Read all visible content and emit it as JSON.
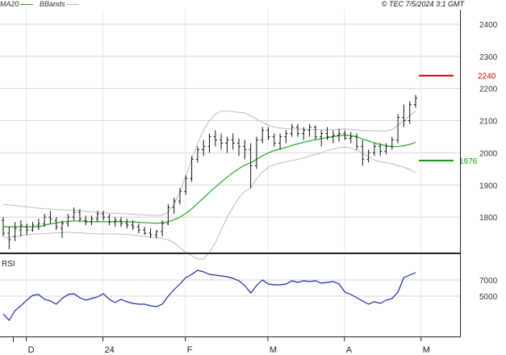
{
  "header": {
    "legend": [
      {
        "label": "MA20",
        "color": "#22aa22"
      },
      {
        "label": "BBands",
        "color": "#bbbbbb"
      }
    ],
    "copyright": "© TEC 7/5/2024 3:1 GMT"
  },
  "colors": {
    "price_bars": "#111111",
    "ma20": "#22aa22",
    "bbands": "#bbbbbb",
    "rsi": "#1a2aa8",
    "resistance": "#cc0000",
    "support": "#119911",
    "grid": "#d6d6d6",
    "axis": "#222222"
  },
  "chart_data": [
    {
      "type": "ohlc",
      "title": "",
      "x_tick_labels": [
        "D",
        "24",
        "F",
        "M",
        "A",
        "M"
      ],
      "y_tick_labels": [
        "2400",
        "2300",
        "2200",
        "2100",
        "2000",
        "1900",
        "1800"
      ],
      "ylim": [
        1690,
        2445
      ],
      "grid": true,
      "levels": [
        {
          "label": "2240",
          "value": 2240,
          "color": "#cc0000"
        },
        {
          "label": "1976",
          "value": 1976,
          "color": "#119911"
        }
      ],
      "series": [
        {
          "name": "",
          "kind": "ohlc",
          "values": [
            [
              1790,
              1800,
              1740,
              1750
            ],
            [
              1750,
              1770,
              1700,
              1730
            ],
            [
              1740,
              1785,
              1725,
              1765
            ],
            [
              1760,
              1790,
              1740,
              1775
            ],
            [
              1770,
              1780,
              1745,
              1760
            ],
            [
              1760,
              1785,
              1755,
              1775
            ],
            [
              1775,
              1795,
              1760,
              1780
            ],
            [
              1780,
              1810,
              1770,
              1800
            ],
            [
              1800,
              1820,
              1780,
              1795
            ],
            [
              1790,
              1800,
              1760,
              1770
            ],
            [
              1765,
              1790,
              1735,
              1780
            ],
            [
              1780,
              1810,
              1770,
              1800
            ],
            [
              1800,
              1830,
              1790,
              1815
            ],
            [
              1815,
              1825,
              1785,
              1795
            ],
            [
              1790,
              1805,
              1775,
              1785
            ],
            [
              1785,
              1805,
              1775,
              1795
            ],
            [
              1795,
              1820,
              1785,
              1810
            ],
            [
              1810,
              1820,
              1790,
              1800
            ],
            [
              1800,
              1810,
              1775,
              1785
            ],
            [
              1785,
              1800,
              1770,
              1790
            ],
            [
              1790,
              1800,
              1770,
              1780
            ],
            [
              1780,
              1795,
              1765,
              1775
            ],
            [
              1775,
              1790,
              1760,
              1770
            ],
            [
              1770,
              1780,
              1750,
              1760
            ],
            [
              1760,
              1770,
              1745,
              1750
            ],
            [
              1750,
              1765,
              1735,
              1745
            ],
            [
              1745,
              1760,
              1735,
              1755
            ],
            [
              1755,
              1790,
              1740,
              1780
            ],
            [
              1780,
              1840,
              1775,
              1830
            ],
            [
              1830,
              1860,
              1810,
              1850
            ],
            [
              1850,
              1890,
              1840,
              1880
            ],
            [
              1880,
              1930,
              1870,
              1920
            ],
            [
              1920,
              1990,
              1910,
              1980
            ],
            [
              1980,
              2020,
              1970,
              2010
            ],
            [
              2010,
              2040,
              1990,
              2020
            ],
            [
              2020,
              2060,
              2000,
              2050
            ],
            [
              2050,
              2070,
              2020,
              2040
            ],
            [
              2040,
              2060,
              2010,
              2030
            ],
            [
              2030,
              2050,
              2000,
              2040
            ],
            [
              2040,
              2060,
              2010,
              2030
            ],
            [
              2030,
              2045,
              1990,
              2020
            ],
            [
              2020,
              2040,
              1980,
              2010
            ],
            [
              2010,
              2030,
              1890,
              1960
            ],
            [
              1960,
              2050,
              1950,
              2040
            ],
            [
              2040,
              2080,
              2030,
              2070
            ],
            [
              2070,
              2080,
              2040,
              2050
            ],
            [
              2050,
              2060,
              2020,
              2030
            ],
            [
              2030,
              2060,
              2010,
              2050
            ],
            [
              2050,
              2070,
              2030,
              2060
            ],
            [
              2060,
              2090,
              2050,
              2080
            ],
            [
              2080,
              2090,
              2050,
              2060
            ],
            [
              2060,
              2080,
              2040,
              2070
            ],
            [
              2070,
              2090,
              2050,
              2080
            ],
            [
              2080,
              2085,
              2040,
              2050
            ],
            [
              2050,
              2070,
              2020,
              2060
            ],
            [
              2060,
              2080,
              2040,
              2050
            ],
            [
              2050,
              2070,
              2030,
              2055
            ],
            [
              2055,
              2075,
              2035,
              2060
            ],
            [
              2060,
              2070,
              2040,
              2045
            ],
            [
              2045,
              2065,
              2030,
              2050
            ],
            [
              2050,
              2060,
              2010,
              2020
            ],
            [
              2020,
              2040,
              1960,
              1980
            ],
            [
              1980,
              2010,
              1970,
              2000
            ],
            [
              2000,
              2030,
              1990,
              2020
            ],
            [
              2020,
              2030,
              1990,
              2005
            ],
            [
              2005,
              2030,
              1995,
              2020
            ],
            [
              2020,
              2050,
              2010,
              2040
            ],
            [
              2040,
              2120,
              2030,
              2110
            ],
            [
              2110,
              2150,
              2080,
              2100
            ],
            [
              2100,
              2160,
              2090,
              2150
            ],
            [
              2150,
              2180,
              2140,
              2170
            ]
          ]
        },
        {
          "name": "MA20",
          "kind": "line",
          "values": [
            1770,
            1770,
            1770,
            1770,
            1770,
            1770,
            1770,
            1775,
            1779,
            1782,
            1785,
            1787,
            1788,
            1788,
            1787,
            1786,
            1786,
            1786,
            1786,
            1786,
            1786,
            1786,
            1785,
            1784,
            1783,
            1782,
            1781,
            1782,
            1786,
            1792,
            1800,
            1812,
            1826,
            1843,
            1860,
            1877,
            1893,
            1909,
            1924,
            1938,
            1951,
            1962,
            1969,
            1980,
            1991,
            2000,
            2007,
            2012,
            2017,
            2023,
            2028,
            2033,
            2037,
            2041,
            2044,
            2047,
            2050,
            2053,
            2055,
            2054,
            2050,
            2043,
            2037,
            2031,
            2026,
            2022,
            2019,
            2020,
            2022,
            2026,
            2033
          ]
        },
        {
          "name": "BBands upper",
          "kind": "line",
          "values": [
            1840,
            1838,
            1836,
            1834,
            1832,
            1830,
            1828,
            1826,
            1825,
            1824,
            1823,
            1822,
            1821,
            1820,
            1818,
            1816,
            1815,
            1814,
            1813,
            1812,
            1811,
            1810,
            1809,
            1808,
            1807,
            1806,
            1805,
            1806,
            1815,
            1840,
            1880,
            1930,
            1980,
            2030,
            2070,
            2100,
            2120,
            2130,
            2130,
            2128,
            2126,
            2124,
            2115,
            2105,
            2095,
            2086,
            2080,
            2077,
            2075,
            2074,
            2074,
            2074,
            2073,
            2072,
            2072,
            2071,
            2072,
            2073,
            2074,
            2073,
            2071,
            2069,
            2069,
            2069,
            2068,
            2068,
            2072,
            2086,
            2100,
            2115,
            2130
          ]
        },
        {
          "name": "BBands lower",
          "kind": "line",
          "values": [
            1735,
            1738,
            1740,
            1743,
            1745,
            1747,
            1748,
            1749,
            1750,
            1751,
            1752,
            1753,
            1752,
            1751,
            1750,
            1749,
            1748,
            1748,
            1748,
            1748,
            1747,
            1746,
            1744,
            1742,
            1740,
            1738,
            1736,
            1734,
            1730,
            1720,
            1705,
            1690,
            1680,
            1670,
            1670,
            1690,
            1720,
            1760,
            1800,
            1830,
            1860,
            1880,
            1890,
            1920,
            1940,
            1955,
            1963,
            1968,
            1972,
            1976,
            1980,
            1984,
            1990,
            1995,
            2000,
            2008,
            2012,
            2016,
            2018,
            2015,
            2008,
            1998,
            1988,
            1978,
            1972,
            1970,
            1966,
            1960,
            1955,
            1948,
            1938
          ]
        }
      ]
    },
    {
      "type": "line",
      "title": "RSI",
      "y_tick_labels": [
        "7000",
        "5000"
      ],
      "ylim": [
        0,
        100
      ],
      "grid": true,
      "series": [
        {
          "name": "",
          "kind": "line",
          "values": [
            28,
            20,
            32,
            38,
            45,
            51,
            52,
            46,
            44,
            40,
            47,
            52,
            53,
            48,
            45,
            47,
            49,
            53,
            46,
            42,
            46,
            43,
            41,
            40,
            40,
            38,
            37,
            40,
            50,
            58,
            65,
            73,
            77,
            82,
            80,
            77,
            76,
            75,
            74,
            72,
            69,
            63,
            54,
            63,
            70,
            65,
            64,
            64,
            65,
            69,
            67,
            69,
            68,
            69,
            66,
            67,
            68,
            65,
            55,
            52,
            48,
            44,
            40,
            43,
            41,
            45,
            47,
            55,
            73,
            76,
            79
          ]
        }
      ]
    }
  ]
}
